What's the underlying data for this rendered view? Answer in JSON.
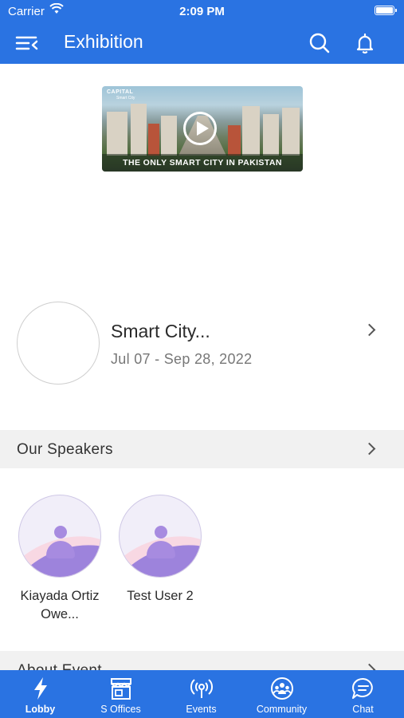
{
  "status_bar": {
    "carrier": "Carrier",
    "time": "2:09 PM"
  },
  "app_bar": {
    "title": "Exhibition"
  },
  "video": {
    "brand": "CAPITAL",
    "brand_sub": "Smart City",
    "caption": "THE ONLY SMART CITY IN PAKISTAN"
  },
  "event": {
    "name": "Smart City...",
    "dates": "Jul 07 - Sep 28, 2022"
  },
  "speakers_section": {
    "title": "Our Speakers"
  },
  "speakers": [
    {
      "name": "Kiayada Ortiz Owe..."
    },
    {
      "name": "Test User 2"
    }
  ],
  "about_section": {
    "title": "About Event"
  },
  "tabs": [
    {
      "label": "Lobby",
      "icon": "lightning-icon",
      "active": true
    },
    {
      "label": "S Offices",
      "icon": "storefront-icon",
      "active": false
    },
    {
      "label": "Events",
      "icon": "broadcast-icon",
      "active": false
    },
    {
      "label": "Community",
      "icon": "community-icon",
      "active": false
    },
    {
      "label": "Chat",
      "icon": "chat-bubble-icon",
      "active": false
    }
  ],
  "colors": {
    "primary": "#2a73e2",
    "section_bg": "#f1f1f1",
    "avatar_purple": "#a78be0"
  }
}
